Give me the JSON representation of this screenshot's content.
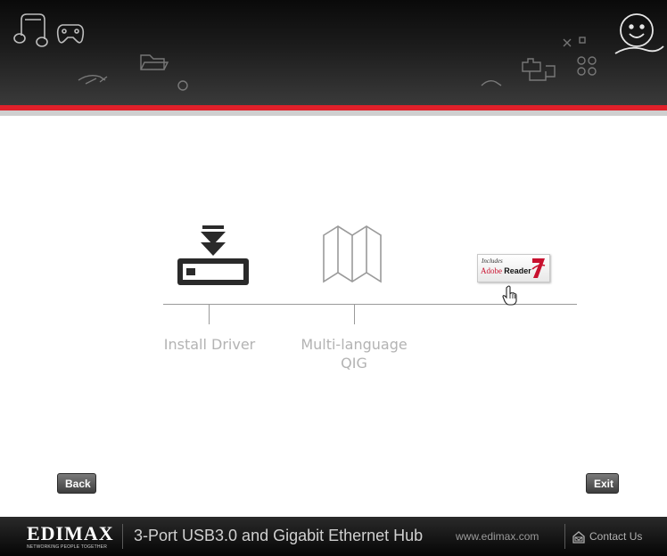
{
  "header": {
    "icons": [
      "music-icon",
      "gamepad-icon",
      "handshake-icon",
      "folder-icon",
      "globe-icon",
      "puzzle-icon",
      "network-icon",
      "smiley-hand-icon"
    ],
    "colors": {
      "bar_top": "#0a0a0a",
      "accent_red": "#e0202a",
      "accent_grey": "#cfcfcf"
    }
  },
  "menu": {
    "items": [
      {
        "label": "Install Driver",
        "icon": "install-driver-icon"
      },
      {
        "label": "Multi-language\nQIG",
        "icon": "map-fold-icon"
      },
      {
        "label": "",
        "icon": "adobe-reader-badge"
      }
    ],
    "adobe_badge": {
      "includes": "Includes",
      "adobe": "Adobe",
      "reader": "Reader"
    }
  },
  "buttons": {
    "back": "Back",
    "exit": "Exit"
  },
  "footer": {
    "brand": "EDIMAX",
    "tagline": "NETWORKING PEOPLE TOGETHER",
    "product": "3-Port USB3.0 and Gigabit Ethernet Hub",
    "website": "www.edimax.com",
    "contact": "Contact Us"
  }
}
